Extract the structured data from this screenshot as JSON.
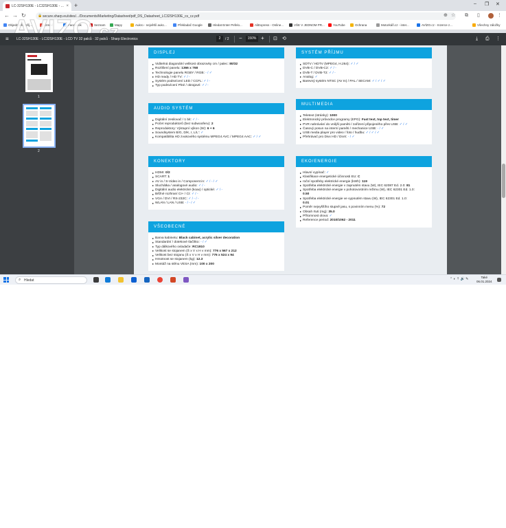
{
  "browser": {
    "tab_title": "LC-32SH130E - LC32SH130E - ...",
    "tab_close": "×",
    "new_tab": "+",
    "window_controls": [
      "–",
      "❐",
      "✕"
    ],
    "url": "secure.sharp.eu/sites/.../Documents/Marketing/Datasheet/pdf_DS_Datasheet_LC32SH130E_cs_cz.pdf",
    "bookmarks": [
      {
        "label": "Objednávky příj...",
        "color": "#4285f4"
      },
      {
        "label": "Gmail",
        "color": "#ea4335"
      },
      {
        "label": "Facebook",
        "color": "#1877f2"
      },
      {
        "label": "Seznam",
        "color": "#cc0000"
      },
      {
        "label": "Mapy",
        "color": "#34a853"
      },
      {
        "label": "Aukro - největší aukc...",
        "color": "#f4b400"
      },
      {
        "label": "Překladač Google",
        "color": "#4285f4"
      },
      {
        "label": "Hledat Enter Pefelo...",
        "color": "#666666"
      },
      {
        "label": "AliExpress - Online...",
        "color": "#e43225"
      },
      {
        "label": "VŠE V JEDNOM PR...",
        "color": "#333333"
      },
      {
        "label": "YouTube",
        "color": "#ff0000"
      },
      {
        "label": "Ochrana",
        "color": "#f4b400"
      },
      {
        "label": "Motorkáři.cz - inter...",
        "color": "#999999"
      },
      {
        "label": "AVÍZO.cz - Inzerce z...",
        "color": "#1a73e8"
      }
    ],
    "all_bookmarks": "Všechny záložky"
  },
  "watermark": {
    "main": "AVIZO",
    "suffix": ".cz"
  },
  "pdf_toolbar": {
    "title": "LC-32SH130E - LC32SH130E - LCD TV 32 palců · 32 palců · Sharp Electronics",
    "page_current": "2",
    "page_total": "/ 2",
    "zoom": "150%"
  },
  "thumbnails": [
    {
      "number": "1"
    },
    {
      "number": "2"
    }
  ],
  "sections": {
    "displej": {
      "title": "DISPLEJ",
      "items": [
        {
          "label": "Viditelná diagonální velikost obrazovky cm / palec:",
          "value": "80/32",
          "check": ""
        },
        {
          "label": "Rozlišení panelu:",
          "value": "1366 x 768",
          "check": ""
        },
        {
          "label": "Technologie panelu RGBY / RGB:",
          "value": "",
          "check": "- / ✓"
        },
        {
          "label": "HD ready / HD TV:",
          "value": "",
          "check": "✓ / -"
        },
        {
          "label": "Systém podsvícení LED / CCFL:",
          "value": "",
          "check": "✓ / -"
        },
        {
          "label": "Typ podsvícení Plné / okrajové:",
          "value": "",
          "check": "✓ / -"
        }
      ]
    },
    "audio": {
      "title": "AUDIO SYSTÉM",
      "items": [
        {
          "label": "Digitální zesilovač / 1 bit:",
          "value": "",
          "check": "✓ / -"
        },
        {
          "label": "Počet reproduktorů (bez subwooferu):",
          "value": "2",
          "check": ""
        },
        {
          "label": "Reproduktory: Výstupní výkon (W):",
          "value": "6 + 6",
          "check": ""
        },
        {
          "label": "Soundsystem B/G, D/K, I, L/L':",
          "value": "",
          "check": "✓"
        },
        {
          "label": "Kompatibilita HD zvukového systému MPEG4 AVC / MPEG4 AAC:",
          "value": "",
          "check": "✓ / ✓"
        }
      ]
    },
    "konektory": {
      "title": "KONEKTORY",
      "items": [
        {
          "label": "HDMI:",
          "value": "0/2",
          "check": ""
        },
        {
          "label": "SCART:",
          "value": "1",
          "check": ""
        },
        {
          "label": "AV in / S-Video in / Component in:",
          "value": "",
          "check": "✓ / - / ✓"
        },
        {
          "label": "Sluchátka / analogové audio:",
          "value": "",
          "check": "✓ / -"
        },
        {
          "label": "Digitální audio elektrické (koax) / optické:",
          "value": "",
          "check": "✓ / -"
        },
        {
          "label": "Běžné rozhraní CI+ / CI:",
          "value": "",
          "check": "✓ / -"
        },
        {
          "label": "VGA / DVI / RS-232C:",
          "value": "",
          "check": "✓ / - / -"
        },
        {
          "label": "WLAN / LAN / USB:",
          "value": "",
          "check": "- / - / ✓"
        }
      ]
    },
    "vseobecne": {
      "title": "VŠEOBECNÉ",
      "items": [
        {
          "label": "Barva kabinetu:",
          "value": "Black cabinet, acrylic silver decoration",
          "check": ""
        },
        {
          "label": "Standardní / dotekové tlačítko:",
          "value": "",
          "check": "- / ✓"
        },
        {
          "label": "Typ dálkového ovladače:",
          "value": "RC1910",
          "check": ""
        },
        {
          "label": "Velikost se stojanem (Š x V x H v mm):",
          "value": "776 x 567 x 212",
          "check": ""
        },
        {
          "label": "Velikost bez stojanu (Š x V x H v mm):",
          "value": "776 x 524 x 94",
          "check": ""
        },
        {
          "label": "Hmotnost se stojanem (kg):",
          "value": "12.3",
          "check": ""
        },
        {
          "label": "Montáž na stěnu VESA (mm):",
          "value": "100 x 200",
          "check": ""
        }
      ]
    },
    "prijem": {
      "title": "SYSTÉM PŘÍJMU",
      "items": [
        {
          "label": "SDTV / HDTV (MPEG4, H.264):",
          "value": "",
          "check": "✓ / ✓"
        },
        {
          "label": "DVB-C / DVB-C2:",
          "value": "",
          "check": "✓ / -"
        },
        {
          "label": "DVB-T / DVB-T2:",
          "value": "",
          "check": "✓ / -"
        },
        {
          "label": "Analog:",
          "value": "",
          "check": "✓"
        },
        {
          "label": "Barevný systém NTSC (AV In) / PAL / SECAM:",
          "value": "",
          "check": "✓ / ✓ / ✓"
        }
      ]
    },
    "multimedia": {
      "title": "MULTIMEDIA",
      "items": [
        {
          "label": "Teletext (stránky):",
          "value": "1000",
          "check": ""
        },
        {
          "label": "Elektronický průvodce programy (EPG):",
          "value": "Fast text, top text, timer",
          "check": ""
        },
        {
          "label": "PVR nahrávání do vnější paměti / zařízení připojeného přes USB:",
          "value": "",
          "check": "✓ / ✓"
        },
        {
          "label": "Časový posun na interní paměti / mechanice USB:",
          "value": "",
          "check": "- / ✓"
        },
        {
          "label": "USB media player pro video / foto / hudbu:",
          "value": "",
          "check": "✓ / ✓ / ✓"
        },
        {
          "label": "Přehrávač pro Divx HD / DivX:",
          "value": "",
          "check": "- / ✓"
        }
      ]
    },
    "eko": {
      "title": "EKO/ENERGIE",
      "items": [
        {
          "label": "Hlavní vypínač:",
          "value": "",
          "check": "✓"
        },
        {
          "label": "Klasifikace energetické účinnosti EU:",
          "value": "C",
          "check": ""
        },
        {
          "label": "roční spotřeby elektrické energie (kWh):",
          "value": "119",
          "check": ""
        },
        {
          "label": "Spotřeba elektrické energie v zapnutém stavu (W), IEC 62087 Ed. 2.0:",
          "value": "81",
          "check": ""
        },
        {
          "label": "Spotřeba elektrické energie v pohotovostním režimu (W), IEC 62301 Ed. 1.0:",
          "value": "",
          "check": ""
        },
        {
          "label": "",
          "value": "0.50",
          "check": ""
        },
        {
          "label": "Spotřeba elektrické energie ve vypnutém stavu (W), IEC 62301 Ed. 1.0:",
          "value": "",
          "check": ""
        },
        {
          "label": "",
          "value": "0.01",
          "check": ""
        },
        {
          "label": "Poměr nejvyššího stupně jasu, s povinním menu (%):",
          "value": "72",
          "check": ""
        },
        {
          "label": "Obsah rtuti (mg):",
          "value": "35.0",
          "check": ""
        },
        {
          "label": "Přítomnost olova:",
          "value": "",
          "check": "✓"
        },
        {
          "label": "Reference period:",
          "value": "2010/1062 - 2011",
          "check": ""
        }
      ]
    }
  },
  "taskbar": {
    "search_label": "Hledat",
    "tray": "⌃  ◐  ⇡  🔊  ✎",
    "clock_day": "Také",
    "clock_date": "06.01.2024"
  }
}
